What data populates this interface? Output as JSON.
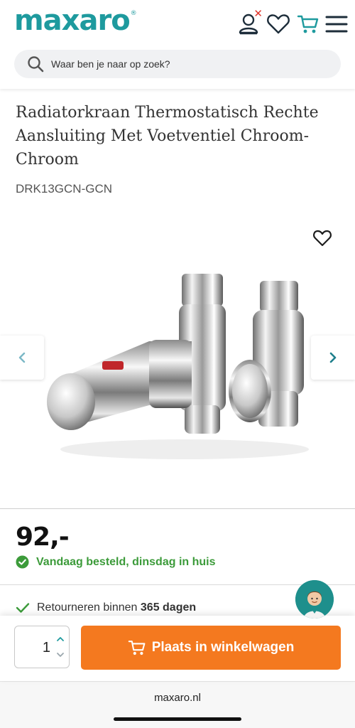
{
  "header": {
    "logo": "maxaro",
    "logo_mark": "®",
    "icons": [
      "account-icon",
      "heart-icon",
      "cart-icon",
      "menu-icon"
    ],
    "account_status_mark": "✕"
  },
  "search": {
    "placeholder": "Waar ben je naar op zoek?"
  },
  "product": {
    "title": "Radiatorkraan Thermostatisch Rechte Aansluiting Met Voetventiel Chroom-Chroom",
    "sku": "DRK13GCN-GCN",
    "price": "92,-",
    "delivery": "Vandaag besteld, dinsdag in huis",
    "returns_prefix": "Retourneren binnen",
    "returns_days": "365 dagen"
  },
  "cart": {
    "quantity": "1",
    "add_label": "Plaats in winkelwagen"
  },
  "browser": {
    "url": "maxaro.nl"
  },
  "colors": {
    "brand": "#1e9a9e",
    "cta": "#f4791f",
    "success": "#3c9b3a",
    "alert": "#e0352b"
  }
}
